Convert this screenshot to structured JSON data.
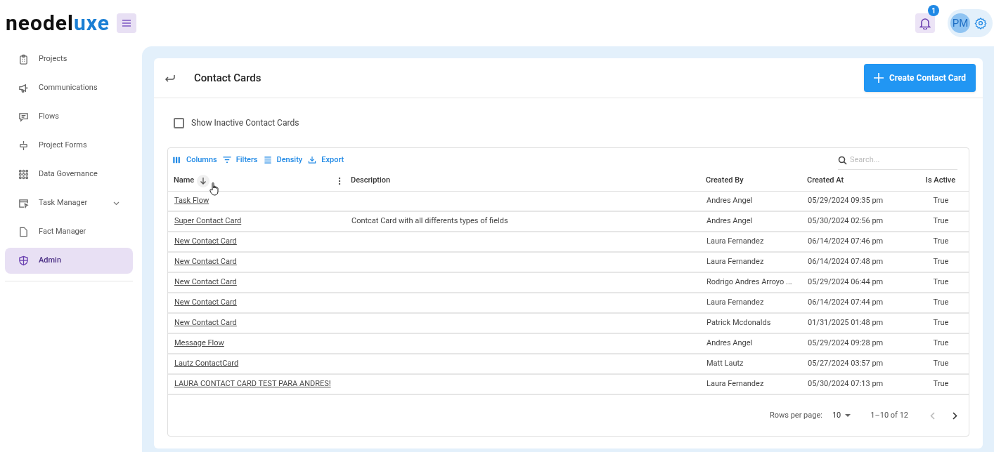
{
  "logo": {
    "main": "neodel",
    "accent": "uxe"
  },
  "header": {
    "notification_count": "1",
    "avatar_initials": "PM"
  },
  "sidebar": {
    "items": [
      {
        "label": "Projects",
        "kind": "link",
        "selected": false
      },
      {
        "label": "Communications",
        "kind": "link",
        "selected": false
      },
      {
        "label": "Flows",
        "kind": "link",
        "selected": false
      },
      {
        "label": "Project Forms",
        "kind": "link",
        "selected": false
      },
      {
        "label": "Data Governance",
        "kind": "link",
        "selected": false
      },
      {
        "label": "Task Manager",
        "kind": "group",
        "selected": false,
        "expanded": false
      },
      {
        "label": "Fact Manager",
        "kind": "link",
        "selected": false
      },
      {
        "label": "Admin",
        "kind": "link",
        "selected": true
      }
    ]
  },
  "page": {
    "title": "Contact Cards",
    "create_button": "Create Contact Card",
    "show_inactive": {
      "label": "Show Inactive Contact Cards",
      "checked": false
    },
    "toolbar": [
      "Columns",
      "Filters",
      "Density",
      "Export"
    ],
    "search": {
      "placeholder": "Search..."
    },
    "table": {
      "columns": [
        {
          "label": "Name",
          "sorted": true
        },
        {
          "label": "Description",
          "sorted": false
        },
        {
          "label": "Created By",
          "sorted": false
        },
        {
          "label": "Created At",
          "sorted": false
        },
        {
          "label": "Is Active",
          "sorted": false
        }
      ],
      "rows": [
        [
          "Task Flow",
          "",
          "Andres Angel",
          "05/29/2024 09:35 pm",
          "True"
        ],
        [
          "Super Contact Card",
          "Contcat Card with all differents types of fields",
          "Andres Angel",
          "05/30/2024 02:56 pm",
          "True"
        ],
        [
          "New Contact Card",
          "",
          "Laura Fernandez",
          "06/14/2024 07:46 pm",
          "True"
        ],
        [
          "New Contact Card",
          "",
          "Laura Fernandez",
          "06/14/2024 07:48 pm",
          "True"
        ],
        [
          "New Contact Card",
          "",
          "Rodrigo Andres Arroyo ...",
          "05/29/2024 06:44 pm",
          "True"
        ],
        [
          "New Contact Card",
          "",
          "Laura Fernandez",
          "06/14/2024 07:44 pm",
          "True"
        ],
        [
          "New Contact Card",
          "",
          "Patrick Mcdonalds",
          "01/31/2025 01:48 pm",
          "True"
        ],
        [
          "Message Flow",
          "",
          "Andres Angel",
          "05/29/2024 09:28 pm",
          "True"
        ],
        [
          "Lautz ContactCard",
          "",
          "Matt Lautz",
          "05/27/2024 03:57 pm",
          "True"
        ],
        [
          "LAURA CONTACT CARD TEST PARA ANDRES!",
          "",
          "Laura Fernandez",
          "05/30/2024 07:13 pm",
          "True"
        ]
      ]
    },
    "pagination": {
      "rows_label": "Rows per page:",
      "rows_value": "10",
      "range": "1–10 of 12",
      "prev_disabled": true,
      "next_disabled": false
    }
  }
}
